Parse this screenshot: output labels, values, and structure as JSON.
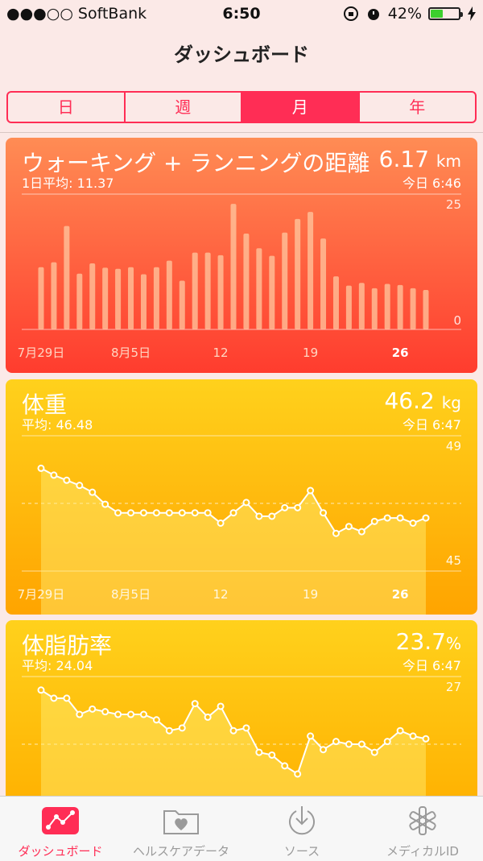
{
  "status": {
    "carrier": "●●●○○ SoftBank",
    "time": "6:50",
    "battery": "42%"
  },
  "nav": {
    "title": "ダッシュボード"
  },
  "segments": [
    {
      "label": "日",
      "active": false
    },
    {
      "label": "週",
      "active": false
    },
    {
      "label": "月",
      "active": true
    },
    {
      "label": "年",
      "active": false
    }
  ],
  "cards": {
    "walking": {
      "title": "ウォーキング + ランニングの距離",
      "value": "6.17",
      "unit": "km",
      "sub": "1日平均: 11.37",
      "time": "今日 6:46"
    },
    "weight": {
      "title": "体重",
      "value": "46.2",
      "unit": "kg",
      "sub": "平均: 46.48",
      "time": "今日 6:47"
    },
    "bodyfat": {
      "title": "体脂肪率",
      "value": "23.7",
      "unit": "%",
      "sub": "平均: 24.04",
      "time": "今日 6:47"
    }
  },
  "chart_data": [
    {
      "type": "bar",
      "title": "ウォーキング + ランニングの距離",
      "x_tick_labels": [
        "7月29日",
        "8月5日",
        "12",
        "19",
        "26"
      ],
      "ylim": [
        0,
        25
      ],
      "y_tick_labels": [
        "25",
        "0"
      ],
      "values": [
        11.5,
        12.4,
        19.1,
        10.3,
        12.2,
        11.4,
        11.2,
        11.5,
        10.2,
        11.5,
        12.7,
        9.0,
        14.2,
        14.2,
        13.7,
        23.2,
        17.7,
        15.0,
        13.6,
        17.9,
        20.4,
        21.7,
        16.8,
        9.8,
        8.1,
        8.6,
        7.6,
        8.4,
        8.2,
        7.6,
        7.3
      ],
      "highlight_label": "26"
    },
    {
      "type": "line",
      "title": "体重",
      "x_tick_labels": [
        "7月29日",
        "8月5日",
        "12",
        "19",
        "26"
      ],
      "ylim": [
        45,
        49
      ],
      "y_tick_labels": [
        "49",
        "45"
      ],
      "values": [
        48.0,
        47.8,
        47.65,
        47.5,
        47.3,
        46.95,
        46.7,
        46.7,
        46.7,
        46.7,
        46.7,
        46.7,
        46.7,
        46.7,
        46.4,
        46.7,
        47.0,
        46.6,
        46.6,
        46.85,
        46.85,
        47.35,
        46.7,
        46.1,
        46.3,
        46.15,
        46.45,
        46.55,
        46.55,
        46.4,
        46.55
      ],
      "highlight_label": "26"
    },
    {
      "type": "line",
      "title": "体脂肪率",
      "y_tick_labels": [
        "27"
      ],
      "values": [
        26.5,
        26.2,
        26.2,
        25.6,
        25.8,
        25.7,
        25.6,
        25.6,
        25.6,
        25.4,
        25.0,
        25.1,
        26.0,
        25.5,
        25.9,
        25.0,
        25.1,
        24.2,
        24.1,
        23.7,
        23.4,
        24.8,
        24.3,
        24.6,
        24.5,
        24.5,
        24.2,
        24.6,
        25.0,
        24.8,
        24.7
      ]
    }
  ],
  "tabbar": {
    "items": [
      {
        "label": "ダッシュボード",
        "icon": "dashboard-icon",
        "active": true
      },
      {
        "label": "ヘルスケアデータ",
        "icon": "health-data-folder-icon",
        "active": false
      },
      {
        "label": "ソース",
        "icon": "sources-download-icon",
        "active": false
      },
      {
        "label": "メディカルID",
        "icon": "medical-id-icon",
        "active": false
      }
    ]
  },
  "colors": {
    "accent": "#ff2d55",
    "walking_top": "#ff8c54",
    "walking_bottom": "#ff3c2e",
    "weight_top": "#ffd11c",
    "weight_bottom": "#ffa400"
  }
}
